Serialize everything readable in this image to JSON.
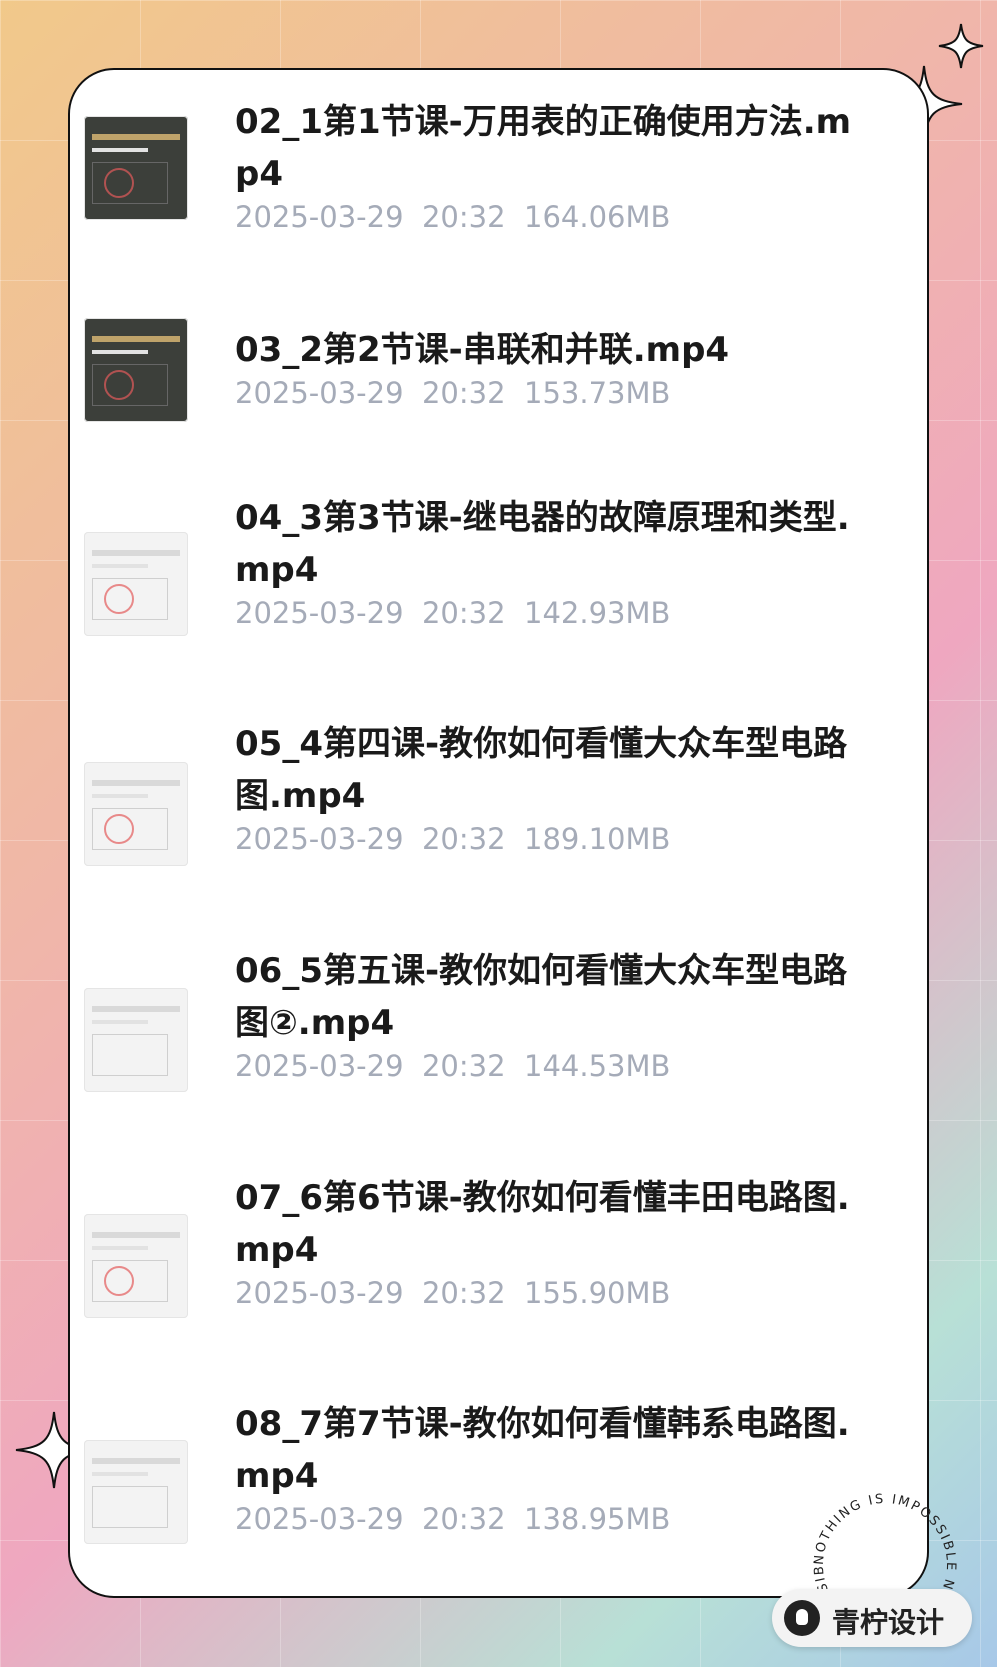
{
  "files": [
    {
      "title": "02_1第1节课-万用表的正确使用方法.mp4",
      "date": "2025-03-29",
      "time": "20:32",
      "size": "164.06MB"
    },
    {
      "title": "03_2第2节课-串联和并联.mp4",
      "date": "2025-03-29",
      "time": "20:32",
      "size": "153.73MB"
    },
    {
      "title": "04_3第3节课-继电器的故障原理和类型.mp4",
      "date": "2025-03-29",
      "time": "20:32",
      "size": "142.93MB"
    },
    {
      "title": "05_4第四课-教你如何看懂大众车型电路图.mp4",
      "date": "2025-03-29",
      "time": "20:32",
      "size": "189.10MB"
    },
    {
      "title": "06_5第五课-教你如何看懂大众车型电路图②.mp4",
      "date": "2025-03-29",
      "time": "20:32",
      "size": "144.53MB"
    },
    {
      "title": "07_6第6节课-教你如何看懂丰田电路图.mp4",
      "date": "2025-03-29",
      "time": "20:32",
      "size": "155.90MB"
    },
    {
      "title": "08_7第7节课-教你如何看懂韩系电路图.mp4",
      "date": "2025-03-29",
      "time": "20:32",
      "size": "138.95MB"
    }
  ],
  "watermark": {
    "badge_text": "青柠设计",
    "circle_text": "NOTHING IS IMPOSSIBLE NOTHING IS IMPOSSIBLE"
  }
}
